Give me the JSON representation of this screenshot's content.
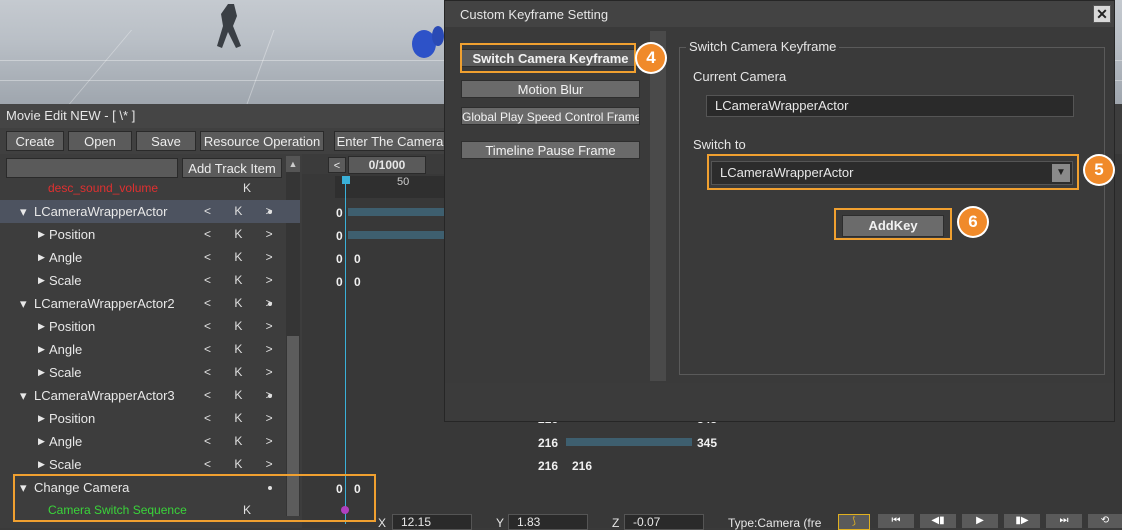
{
  "editor": {
    "title": "Movie Edit NEW - [ \\* ]",
    "toolbar": {
      "create": "Create",
      "open": "Open",
      "save": "Save",
      "resource_operation": "Resource Operation",
      "enter_camera": "Enter The Camera"
    },
    "add_track_item": "Add Track Item",
    "frame_counter": "0/1000",
    "ruler_tick": "50",
    "tracks": [
      {
        "label": "desc_sound_volume",
        "level": 1,
        "color": "#e03030",
        "controls": "K"
      },
      {
        "label": "LCameraWrapperActor",
        "level": 0,
        "controls": "< K >",
        "value": "0"
      },
      {
        "label": "Position",
        "level": 1,
        "controls": "< K >",
        "value": "0"
      },
      {
        "label": "Angle",
        "level": 1,
        "controls": "< K >",
        "value": "0",
        "value2": "0"
      },
      {
        "label": "Scale",
        "level": 1,
        "controls": "< K >",
        "value": "0",
        "value2": "0"
      },
      {
        "label": "LCameraWrapperActor2",
        "level": 0,
        "controls": "< K >"
      },
      {
        "label": "Position",
        "level": 1,
        "controls": "< K >"
      },
      {
        "label": "Angle",
        "level": 1,
        "controls": "< K >"
      },
      {
        "label": "Scale",
        "level": 1,
        "controls": "< K >"
      },
      {
        "label": "LCameraWrapperActor3",
        "level": 0,
        "controls": "< K >"
      },
      {
        "label": "Position",
        "level": 1,
        "controls": "< K >"
      },
      {
        "label": "Angle",
        "level": 1,
        "controls": "< K >"
      },
      {
        "label": "Scale",
        "level": 1,
        "controls": "< K >"
      },
      {
        "label": "Change Camera",
        "level": 0,
        "controls": "",
        "value": "0",
        "value2": "0"
      },
      {
        "label": "Camera Switch Sequence",
        "level": 1,
        "color": "#3ad43a",
        "controls": "K"
      }
    ],
    "timeline_values": {
      "row_a_left": "216",
      "row_a_right": "345",
      "row_b_left": "216",
      "row_b_right": "345",
      "row_c_left": "216",
      "row_c_right": "216"
    },
    "statusbar": {
      "x_label": "X",
      "x_value": "12.15",
      "y_label": "Y",
      "y_value": "1.83",
      "z_label": "Z",
      "z_value": "-0.07",
      "type_text": "Type:Camera (fre"
    }
  },
  "dialog": {
    "title": "Custom Keyframe Setting",
    "menu": {
      "switch_camera_keyframe": "Switch Camera Keyframe",
      "motion_blur": "Motion Blur",
      "global_play_speed": "Global Play Speed Control Frame",
      "timeline_pause_frame": "Timeline Pause Frame"
    },
    "group_title": "Switch Camera Keyframe",
    "current_camera_label": "Current Camera",
    "current_camera_value": "LCameraWrapperActor",
    "switch_to_label": "Switch to",
    "switch_to_value": "LCameraWrapperActor",
    "addkey": "AddKey"
  },
  "badges": {
    "b4": "4",
    "b5": "5",
    "b6": "6"
  }
}
